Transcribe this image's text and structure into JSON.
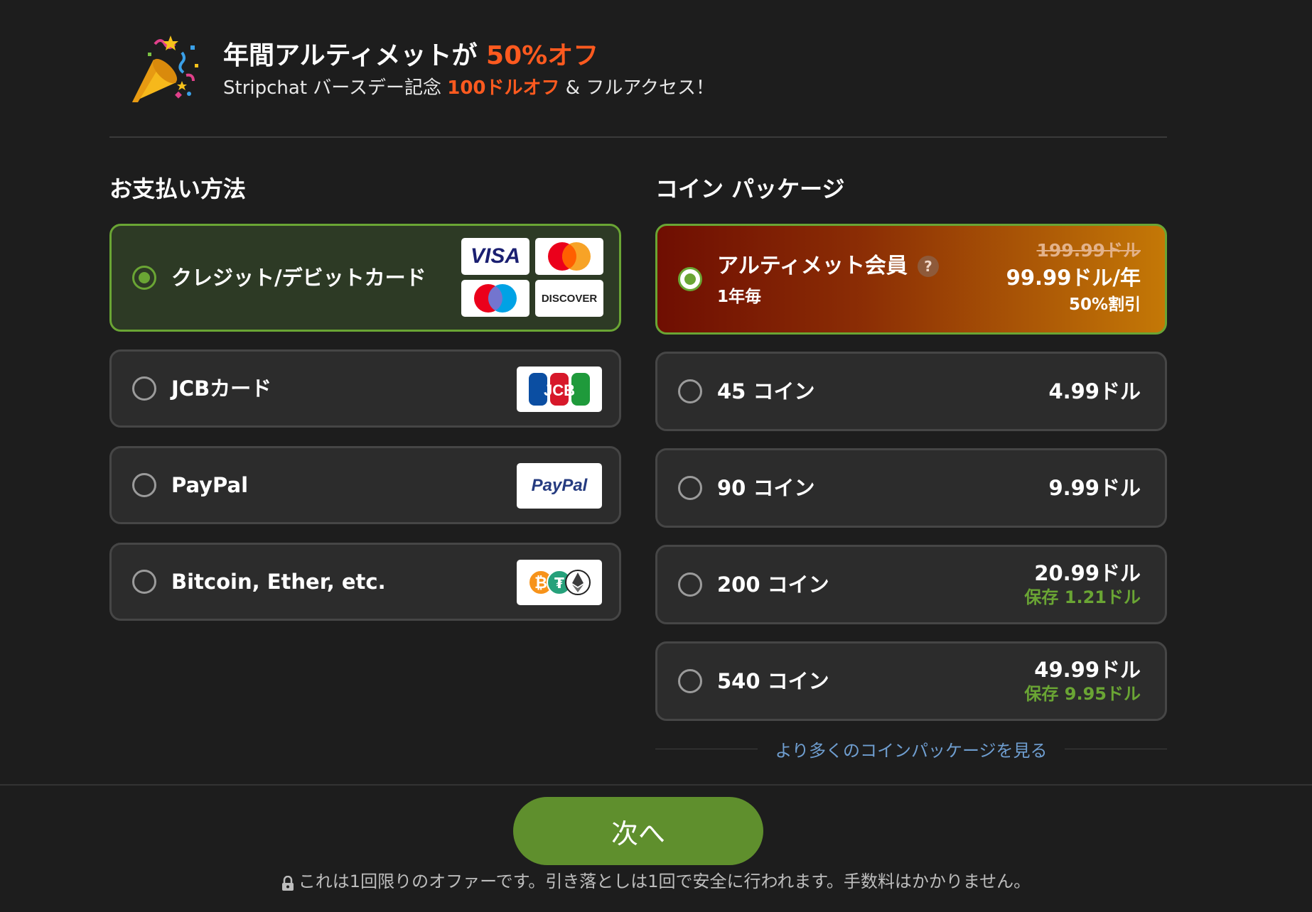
{
  "promo": {
    "title_prefix": "年間アルティメットが",
    "title_highlight": "50%オフ",
    "subtitle_prefix": "Stripchat バースデー記念",
    "subtitle_highlight": "100ドルオフ",
    "subtitle_suffix": "& フルアクセス！",
    "icon": "party-popper-icon"
  },
  "payment": {
    "title": "お支払い方法",
    "methods": [
      {
        "label": "クレジット/デビットカード",
        "selected": true,
        "logos": [
          "VISA",
          "mastercard",
          "maestro",
          "DISCOVER"
        ]
      },
      {
        "label": "JCBカード",
        "selected": false,
        "logos": [
          "JCB"
        ]
      },
      {
        "label": "PayPal",
        "selected": false,
        "logos": [
          "PayPal"
        ]
      },
      {
        "label": "Bitcoin, Ether, etc.",
        "selected": false,
        "logos": [
          "crypto"
        ]
      }
    ]
  },
  "coins": {
    "title": "コイン パッケージ",
    "ultimate": {
      "name": "アルティメット会員",
      "help": "?",
      "period": "1年毎",
      "old_price": "199.99ドル",
      "price": "99.99ドル/年",
      "discount": "50%割引",
      "selected": true
    },
    "packages": [
      {
        "label": "45 コイン",
        "price": "4.99ドル",
        "save": ""
      },
      {
        "label": "90 コイン",
        "price": "9.99ドル",
        "save": ""
      },
      {
        "label": "200 コイン",
        "price": "20.99ドル",
        "save": "保存 1.21ドル"
      },
      {
        "label": "540 コイン",
        "price": "49.99ドル",
        "save": "保存 9.95ドル"
      }
    ],
    "more_link": "より多くのコインパッケージを見る"
  },
  "footer": {
    "next_button": "次へ",
    "note": "これは1回限りのオファーです。引き落としは1回で安全に行われます。手数料はかかりません。"
  },
  "colors": {
    "accent_green": "#6aa534",
    "button_green": "#5f8f2d",
    "highlight_orange": "#ff5a1f",
    "background": "#1d1d1d"
  }
}
